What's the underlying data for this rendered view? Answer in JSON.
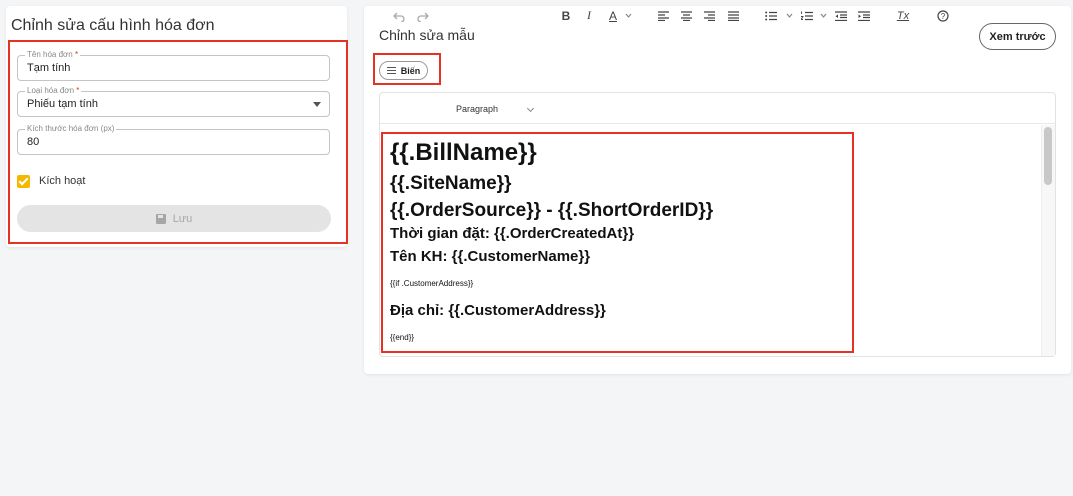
{
  "left": {
    "title": "Chỉnh sửa cấu hình hóa đơn",
    "fields": [
      {
        "label": "Tên hóa đơn",
        "required": "*",
        "value": "Tạm tính"
      },
      {
        "label": "Loại hóa đơn",
        "required": "*",
        "value": "Phiếu tạm tính"
      },
      {
        "label": "Kích thước hóa đơn (px)",
        "value": "80"
      }
    ],
    "active_label": "Kích hoạt",
    "active_checked": true,
    "save_label": "Lưu"
  },
  "right": {
    "title": "Chỉnh sửa mẫu",
    "preview_label": "Xem trước",
    "variables_label": "Biến",
    "toolbar": {
      "block_format": "Paragraph",
      "bold": "B",
      "italic": "I",
      "font_color": "A",
      "clear_format": "Tx",
      "help": "?"
    },
    "content": [
      "{{.BillName}}",
      "{{.SiteName}}",
      "{{.OrderSource}} - {{.ShortOrderID}}",
      "Thời gian đặt: {{.OrderCreatedAt}}",
      "Tên KH: {{.CustomerName}}",
      "{{if .CustomerAddress}}",
      "Địa chỉ: {{.CustomerAddress}}",
      "{{end}}"
    ]
  },
  "colors": {
    "highlight": "#e53222",
    "checkbox": "#f5b800"
  }
}
